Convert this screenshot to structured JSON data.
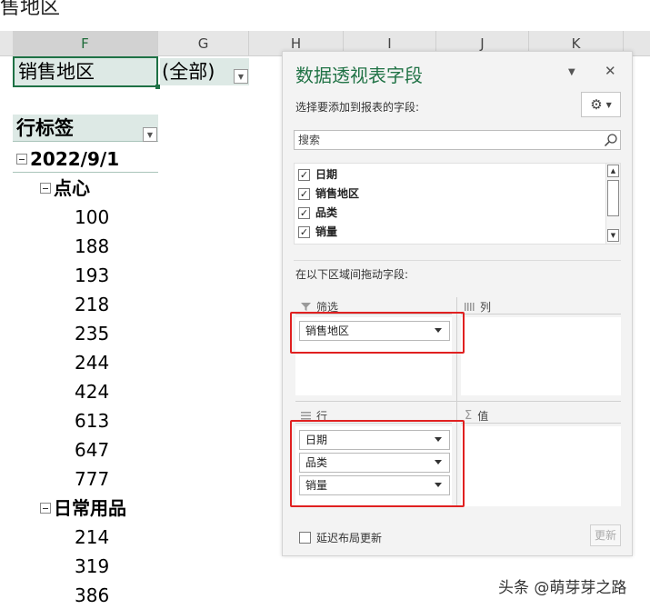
{
  "sheet": {
    "title_fragment": "售地区",
    "columns": [
      "F",
      "G",
      "H",
      "I",
      "J",
      "K"
    ],
    "filter_label": "销售地区",
    "filter_value": "(全部)",
    "row_labels_header": "行标签",
    "rows": [
      {
        "text": "2022/9/1",
        "level": 0,
        "collapsible": true
      },
      {
        "text": "点心",
        "level": 1,
        "collapsible": true
      },
      {
        "text": "100",
        "level": 2
      },
      {
        "text": "188",
        "level": 2
      },
      {
        "text": "193",
        "level": 2
      },
      {
        "text": "218",
        "level": 2
      },
      {
        "text": "235",
        "level": 2
      },
      {
        "text": "244",
        "level": 2
      },
      {
        "text": "424",
        "level": 2
      },
      {
        "text": "613",
        "level": 2
      },
      {
        "text": "647",
        "level": 2
      },
      {
        "text": "777",
        "level": 2
      },
      {
        "text": "日常用品",
        "level": 1,
        "collapsible": true
      },
      {
        "text": "214",
        "level": 2
      },
      {
        "text": "319",
        "level": 2
      },
      {
        "text": "386",
        "level": 2
      }
    ]
  },
  "pane": {
    "title": "数据透视表字段",
    "subtitle": "选择要添加到报表的字段:",
    "search_placeholder": "搜索",
    "fields": [
      {
        "label": "日期",
        "checked": true
      },
      {
        "label": "销售地区",
        "checked": true
      },
      {
        "label": "品类",
        "checked": true
      },
      {
        "label": "销量",
        "checked": true
      }
    ],
    "drag_hint": "在以下区域间拖动字段:",
    "areas": {
      "filters": {
        "label": "筛选",
        "items": [
          "销售地区"
        ]
      },
      "columns": {
        "label": "列",
        "items": []
      },
      "rows": {
        "label": "行",
        "items": [
          "日期",
          "品类",
          "销量"
        ]
      },
      "values": {
        "label": "值",
        "items": []
      }
    },
    "defer_update_label": "延迟布局更新",
    "update_button": "更新"
  },
  "watermark": "头条 @萌芽芽之路",
  "colors": {
    "accent_green": "#217346",
    "highlight_red": "#e02020",
    "pivot_fill": "#dde9e5"
  }
}
